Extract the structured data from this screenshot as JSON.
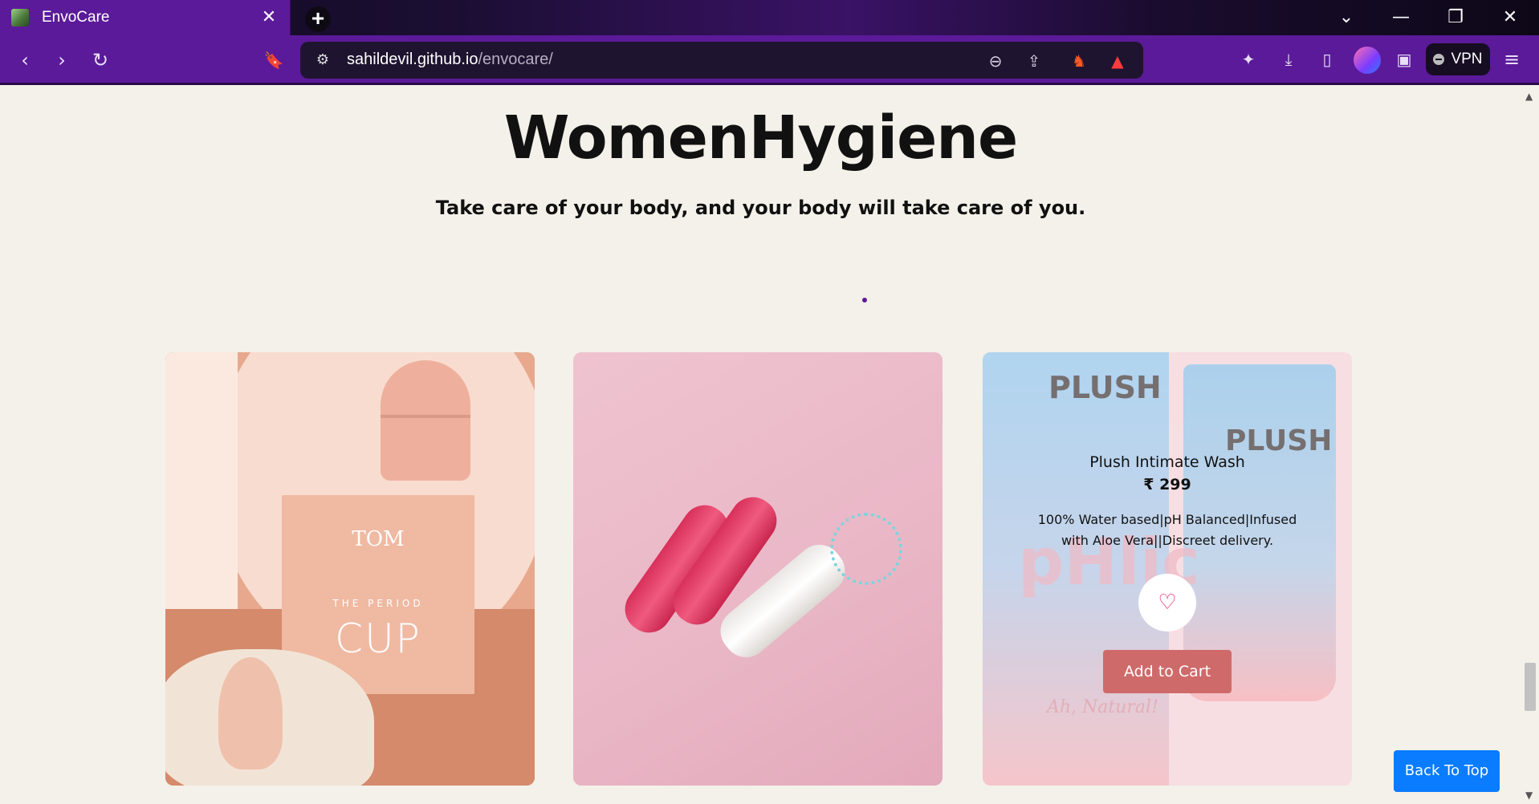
{
  "browser": {
    "tab": {
      "title": "EnvoCare",
      "close_glyph": "✕"
    },
    "new_tab_glyph": "+",
    "window_controls": {
      "tablist": "⌄",
      "minimize": "—",
      "restore": "❐",
      "close": "✕"
    },
    "nav": {
      "back": "‹",
      "forward": "›",
      "reload": "↻",
      "bookmark": "🔖"
    },
    "address": {
      "host": "sahildevil.github.io",
      "path": "/envocare/"
    },
    "omnibox_icons": {
      "site_info": "⚙",
      "zoom": "⊖",
      "share": "⇪",
      "brave_shields": "♞",
      "rewards": "▲"
    },
    "toolbar_icons": {
      "extensions": "✦",
      "downloads": "⤓",
      "sidebar": "▯",
      "wallet": "▣",
      "menu": "≡"
    },
    "vpn_label": "VPN",
    "colors": {
      "chrome_purple": "#5b1a99",
      "omnibox": "#1f1430"
    }
  },
  "page": {
    "title": "WomenHygiene",
    "tagline": "Take care of your body, and your body will take care of you.",
    "background": "#f3f1e9",
    "products": [
      {
        "image": "period-cup",
        "box_brand": "TOM",
        "box_sub": "THE PERIOD",
        "box_label": "CUP"
      },
      {
        "image": "tampons"
      },
      {
        "image": "plush-intimate-wash",
        "brand_text": "PLUSH",
        "ph_text": "pHlic",
        "natural_text": "Ah, Natural!",
        "name": "Plush Intimate Wash",
        "price": "₹ 299",
        "description": "100% Water based|pH Balanced|Infused with Aloe Vera||Discreet delivery.",
        "wishlist_icon": "♡",
        "add_to_cart_label": "Add to Cart",
        "button_color": "#cf6a6a"
      }
    ],
    "back_to_top_label": "Back To Top",
    "back_to_top_color": "#0a7cff"
  }
}
